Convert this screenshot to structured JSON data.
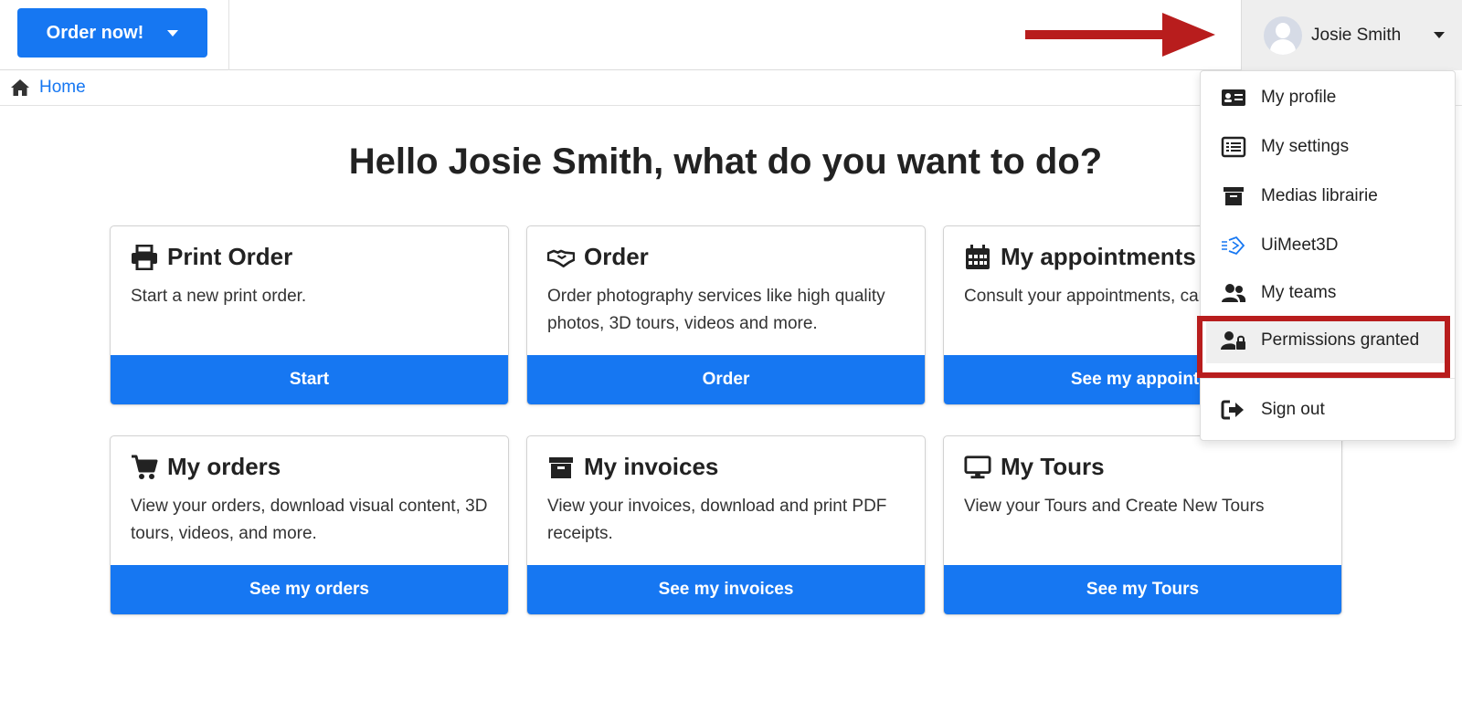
{
  "header": {
    "order_now_label": "Order now!",
    "user_name": "Josie Smith"
  },
  "breadcrumb": {
    "home_label": "Home"
  },
  "page": {
    "title": "Hello Josie Smith, what do you want to do?"
  },
  "cards": [
    {
      "title": "Print Order",
      "icon": "printer-icon",
      "description": "Start a new print order.",
      "button": "Start"
    },
    {
      "title": "Order",
      "icon": "handshake-icon",
      "description": "Order photography services like high quality photos, 3D tours, videos and more.",
      "button": "Order"
    },
    {
      "title": "My appointments",
      "icon": "calendar-icon",
      "description": "Consult your appointments, cancel them.",
      "button": "See my appointm"
    },
    {
      "title": "My orders",
      "icon": "cart-icon",
      "description": "View your orders, download visual content, 3D tours, videos, and more.",
      "button": "See my orders"
    },
    {
      "title": "My invoices",
      "icon": "archive-icon",
      "description": "View your invoices, download and print PDF receipts.",
      "button": "See my invoices"
    },
    {
      "title": "My Tours",
      "icon": "monitor-icon",
      "description": "View your Tours and Create New Tours",
      "button": "See my Tours"
    }
  ],
  "user_dropdown": {
    "items": [
      {
        "label": "My profile",
        "icon": "id-card-icon"
      },
      {
        "label": "My settings",
        "icon": "list-icon"
      },
      {
        "label": "Medias librairie",
        "icon": "archive-icon"
      },
      {
        "label": "UiMeet3D",
        "icon": "uimeet3d-logo-icon"
      },
      {
        "label": "My teams",
        "icon": "users-icon"
      },
      {
        "label": "Permissions granted",
        "icon": "user-lock-icon"
      },
      {
        "label": "Sign out",
        "icon": "sign-out-icon"
      }
    ]
  },
  "colors": {
    "primary": "#1677f2",
    "annotation_red": "#b81d1d",
    "text": "#222222",
    "user_menu_bg": "#eeeeee"
  }
}
